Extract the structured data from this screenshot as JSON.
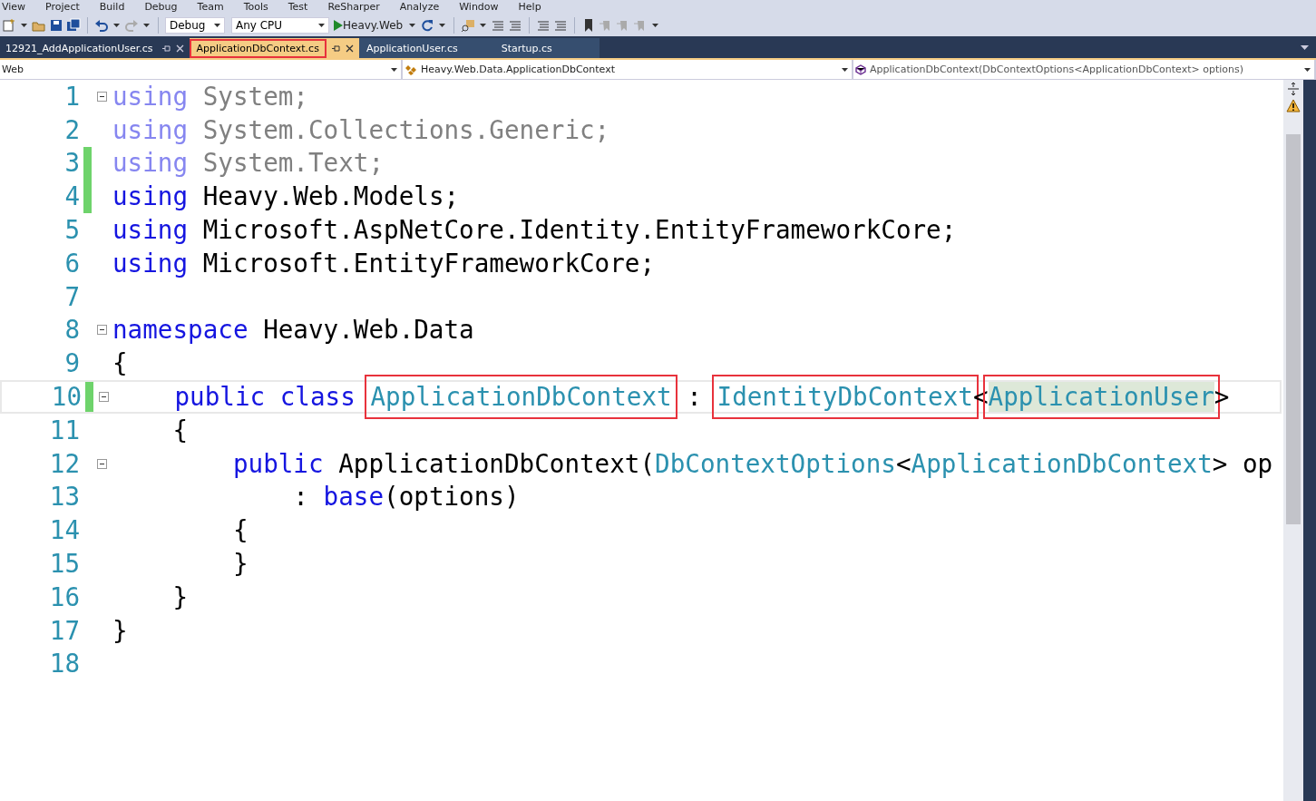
{
  "menu": [
    "View",
    "Project",
    "Build",
    "Debug",
    "Team",
    "Tools",
    "Test",
    "ReSharper",
    "Analyze",
    "Window",
    "Help"
  ],
  "toolbar": {
    "configuration": "Debug",
    "platform": "Any CPU",
    "start": "Heavy.Web"
  },
  "tabs": [
    {
      "label": "12921_AddApplicationUser.cs",
      "selected": false,
      "pinned": true,
      "boxed": false
    },
    {
      "label": "ApplicationDbContext.cs",
      "selected": true,
      "pinned": true,
      "boxed": true
    },
    {
      "label": "ApplicationUser.cs",
      "selected": false,
      "pinned": false,
      "boxed": false
    },
    {
      "label": "Startup.cs",
      "selected": false,
      "pinned": false,
      "boxed": false
    }
  ],
  "navigation": {
    "project": "Web",
    "type": "Heavy.Web.Data.ApplicationDbContext",
    "member": "ApplicationDbContext(DbContextOptions<ApplicationDbContext> options)"
  },
  "editor": {
    "lines": [
      {
        "number": "1",
        "fold": true,
        "changed": false,
        "current": false,
        "tokens": [
          {
            "kind": "faded-keyword",
            "text": "using"
          },
          {
            "kind": "faded",
            "text": " System;"
          }
        ]
      },
      {
        "number": "2",
        "fold": false,
        "changed": false,
        "current": false,
        "tokens": [
          {
            "kind": "faded-keyword",
            "text": "using"
          },
          {
            "kind": "faded",
            "text": " System.Collections.Generic;"
          }
        ]
      },
      {
        "number": "3",
        "fold": false,
        "changed": true,
        "current": false,
        "tokens": [
          {
            "kind": "faded-keyword",
            "text": "using"
          },
          {
            "kind": "faded",
            "text": " System.Text;"
          }
        ]
      },
      {
        "number": "4",
        "fold": false,
        "changed": true,
        "current": false,
        "tokens": [
          {
            "kind": "keyword",
            "text": "using"
          },
          {
            "kind": "plain",
            "text": " Heavy.Web.Models;"
          }
        ]
      },
      {
        "number": "5",
        "fold": false,
        "changed": false,
        "current": false,
        "tokens": [
          {
            "kind": "keyword",
            "text": "using"
          },
          {
            "kind": "plain",
            "text": " Microsoft.AspNetCore.Identity.EntityFrameworkCore;"
          }
        ]
      },
      {
        "number": "6",
        "fold": false,
        "changed": false,
        "current": false,
        "tokens": [
          {
            "kind": "keyword",
            "text": "using"
          },
          {
            "kind": "plain",
            "text": " Microsoft.EntityFrameworkCore;"
          }
        ]
      },
      {
        "number": "7",
        "fold": false,
        "changed": false,
        "current": false
      },
      {
        "number": "8",
        "fold": true,
        "changed": false,
        "current": false,
        "tokens": [
          {
            "kind": "keyword",
            "text": "namespace"
          },
          {
            "kind": "plain",
            "text": " Heavy.Web.Data"
          }
        ]
      },
      {
        "number": "9",
        "fold": false,
        "changed": false,
        "current": false,
        "tokens": [
          {
            "kind": "plain",
            "text": "{"
          }
        ]
      },
      {
        "number": "10",
        "fold": true,
        "changed": true,
        "current": true,
        "tokens": [
          {
            "kind": "keyword",
            "text": "    public class "
          },
          {
            "kind": "type",
            "text": "ApplicationDbContext",
            "boxed": true
          },
          {
            "kind": "plain",
            "text": " : "
          },
          {
            "kind": "type",
            "text": "IdentityDbContext",
            "boxed": true
          },
          {
            "kind": "plain",
            "text": "<"
          },
          {
            "kind": "type",
            "text": "ApplicationUser",
            "boxed": true,
            "highlighted": true
          },
          {
            "kind": "plain",
            "text": ">"
          }
        ]
      },
      {
        "number": "11",
        "fold": false,
        "changed": false,
        "current": false,
        "tokens": [
          {
            "kind": "plain",
            "text": "    {"
          }
        ]
      },
      {
        "number": "12",
        "fold": true,
        "changed": false,
        "current": false,
        "tokens": [
          {
            "kind": "keyword",
            "text": "        public"
          },
          {
            "kind": "plain",
            "text": " ApplicationDbContext("
          },
          {
            "kind": "type",
            "text": "DbContextOptions"
          },
          {
            "kind": "plain",
            "text": "<"
          },
          {
            "kind": "type",
            "text": "ApplicationDbContext"
          },
          {
            "kind": "plain",
            "text": "> op"
          }
        ]
      },
      {
        "number": "13",
        "fold": false,
        "changed": false,
        "current": false,
        "tokens": [
          {
            "kind": "plain",
            "text": "            : "
          },
          {
            "kind": "keyword",
            "text": "base"
          },
          {
            "kind": "plain",
            "text": "(options)"
          }
        ]
      },
      {
        "number": "14",
        "fold": false,
        "changed": false,
        "current": false,
        "tokens": [
          {
            "kind": "plain",
            "text": "        {"
          }
        ]
      },
      {
        "number": "15",
        "fold": false,
        "changed": false,
        "current": false,
        "tokens": [
          {
            "kind": "plain",
            "text": "        }"
          }
        ]
      },
      {
        "number": "16",
        "fold": false,
        "changed": false,
        "current": false,
        "tokens": [
          {
            "kind": "plain",
            "text": "    }"
          }
        ]
      },
      {
        "number": "17",
        "fold": false,
        "changed": false,
        "current": false,
        "tokens": [
          {
            "kind": "plain",
            "text": "}"
          }
        ]
      },
      {
        "number": "18",
        "fold": false,
        "changed": false,
        "current": false
      }
    ]
  }
}
